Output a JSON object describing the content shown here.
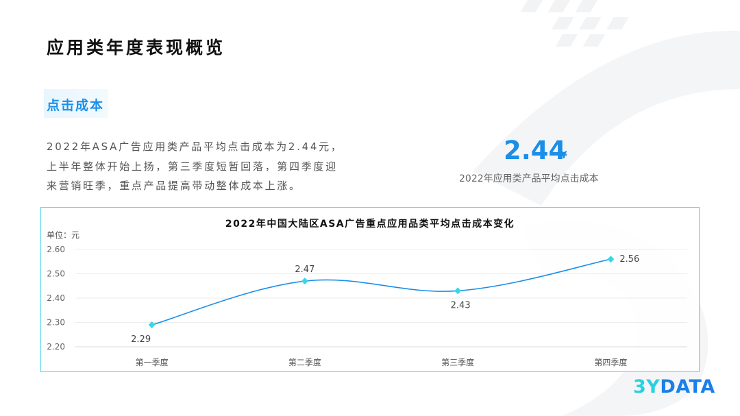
{
  "page": {
    "title": "应用类年度表现概览",
    "section_title": "点击成本",
    "description_lines": [
      "2022年ASA广告应用类产品平均点击成本为2.44元，",
      "上半年整体开始上扬，第三季度短暂回落，第四季度迎",
      "来营销旺季，重点产品提高带动整体成本上涨。"
    ],
    "kpi": {
      "value": "2.44",
      "unit": "¥",
      "label": "2022年应用类产品平均点击成本"
    },
    "logo": {
      "prefix": "3Y",
      "suffix": "DATA"
    }
  },
  "colors": {
    "accent": "#1a8fe8",
    "line": "#1a8fe8",
    "marker": "#3ad6e8",
    "frame": "#58d3ec"
  },
  "chart_data": {
    "type": "line",
    "title": "2022年中国大陆区ASA广告重点应用品类平均点击成本变化",
    "unit_label": "单位：元",
    "categories": [
      "第一季度",
      "第二季度",
      "第三季度",
      "第四季度"
    ],
    "values": [
      2.29,
      2.47,
      2.43,
      2.56
    ],
    "data_labels": [
      "2.29",
      "2.47",
      "2.43",
      "2.56"
    ],
    "label_positions": [
      "below",
      "above",
      "below",
      "right"
    ],
    "yticks": [
      "2.20",
      "2.30",
      "2.40",
      "2.50",
      "2.60"
    ],
    "ytick_values": [
      2.2,
      2.3,
      2.4,
      2.5,
      2.6
    ],
    "ylim": [
      2.2,
      2.6
    ],
    "grid": true,
    "smooth": true
  }
}
